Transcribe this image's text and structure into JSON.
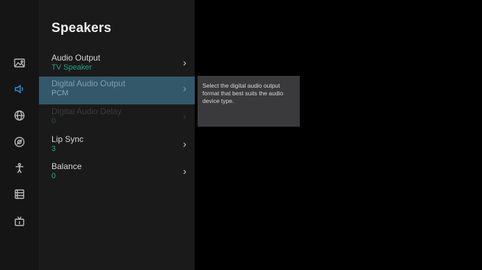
{
  "menu": {
    "title": "Speakers",
    "items": [
      {
        "label": "Audio Output",
        "value": "TV Speaker",
        "chevron": "›"
      },
      {
        "label": "Digital Audio Output",
        "value": "PCM",
        "chevron": "›"
      },
      {
        "label": "Digital Audio Delay",
        "value": "0",
        "chevron": "›"
      },
      {
        "label": "Lip Sync",
        "value": "3",
        "chevron": "›"
      },
      {
        "label": "Balance",
        "value": "0",
        "chevron": "›"
      }
    ],
    "selected_index": 1,
    "disabled_index": 2
  },
  "tooltip": {
    "text": "Select the digital audio output format that best suits the audio device type."
  },
  "rail": {
    "icons": [
      "picture-icon",
      "sound-icon",
      "network-icon",
      "general-icon",
      "accessibility-icon",
      "system-icon",
      "channel-icon"
    ],
    "active_icon": "sound-icon"
  },
  "colors": {
    "accent_value": "#1fa884",
    "selected_row": "#33586a",
    "active_icon": "#2a8fd6",
    "panel": "#1a1a1b",
    "rail": "#151516",
    "tooltip": "#3a3a3c"
  }
}
